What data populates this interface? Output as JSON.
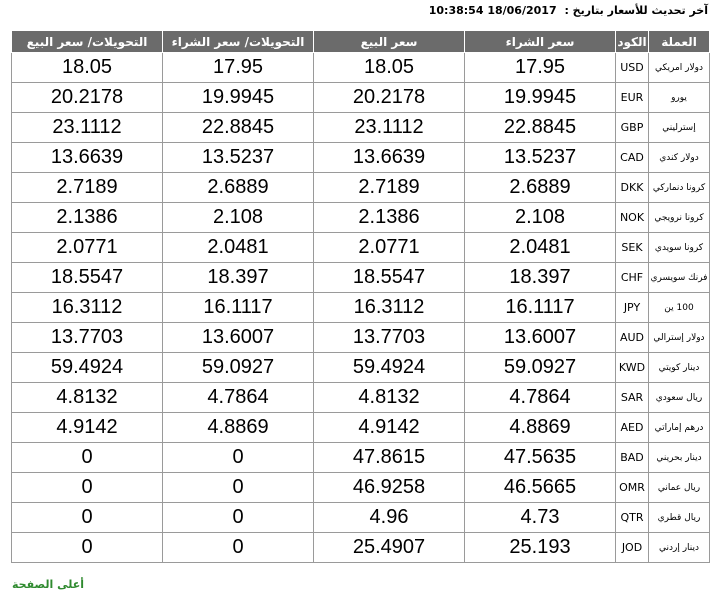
{
  "header": {
    "updated_label": "آخر تحديث للأسعار بتاريخ :",
    "updated_value": "18/06/2017 10:38:54"
  },
  "table": {
    "columns": [
      "العملة",
      "الكود",
      "سعر الشراء",
      "سعر البيع",
      "التحويلات/ سعر الشراء",
      "التحويلات/ سعر البيع"
    ],
    "rows": [
      {
        "name": "دولار امريكي",
        "code": "USD",
        "buy": "17.95",
        "sell": "18.05",
        "transfer_buy": "17.95",
        "transfer_sell": "18.05"
      },
      {
        "name": "يورو",
        "code": "EUR",
        "buy": "19.9945",
        "sell": "20.2178",
        "transfer_buy": "19.9945",
        "transfer_sell": "20.2178"
      },
      {
        "name": "إسترليني",
        "code": "GBP",
        "buy": "22.8845",
        "sell": "23.1112",
        "transfer_buy": "22.8845",
        "transfer_sell": "23.1112"
      },
      {
        "name": "دولار كندي",
        "code": "CAD",
        "buy": "13.5237",
        "sell": "13.6639",
        "transfer_buy": "13.5237",
        "transfer_sell": "13.6639"
      },
      {
        "name": "كرونا دنماركي",
        "code": "DKK",
        "buy": "2.6889",
        "sell": "2.7189",
        "transfer_buy": "2.6889",
        "transfer_sell": "2.7189"
      },
      {
        "name": "كرونا نرويجي",
        "code": "NOK",
        "buy": "2.108",
        "sell": "2.1386",
        "transfer_buy": "2.108",
        "transfer_sell": "2.1386"
      },
      {
        "name": "كرونا سويدي",
        "code": "SEK",
        "buy": "2.0481",
        "sell": "2.0771",
        "transfer_buy": "2.0481",
        "transfer_sell": "2.0771"
      },
      {
        "name": "فرنك سويسري",
        "code": "CHF",
        "buy": "18.397",
        "sell": "18.5547",
        "transfer_buy": "18.397",
        "transfer_sell": "18.5547"
      },
      {
        "name": "100 ين",
        "code": "JPY",
        "buy": "16.1117",
        "sell": "16.3112",
        "transfer_buy": "16.1117",
        "transfer_sell": "16.3112"
      },
      {
        "name": "دولار إسترالي",
        "code": "AUD",
        "buy": "13.6007",
        "sell": "13.7703",
        "transfer_buy": "13.6007",
        "transfer_sell": "13.7703"
      },
      {
        "name": "دينار كويتي",
        "code": "KWD",
        "buy": "59.0927",
        "sell": "59.4924",
        "transfer_buy": "59.0927",
        "transfer_sell": "59.4924"
      },
      {
        "name": "ريال سعودي",
        "code": "SAR",
        "buy": "4.7864",
        "sell": "4.8132",
        "transfer_buy": "4.7864",
        "transfer_sell": "4.8132"
      },
      {
        "name": "درهم إماراتي",
        "code": "AED",
        "buy": "4.8869",
        "sell": "4.9142",
        "transfer_buy": "4.8869",
        "transfer_sell": "4.9142"
      },
      {
        "name": "دينار بحريني",
        "code": "BAD",
        "buy": "47.5635",
        "sell": "47.8615",
        "transfer_buy": "0",
        "transfer_sell": "0"
      },
      {
        "name": "ريال عماني",
        "code": "OMR",
        "buy": "46.5665",
        "sell": "46.9258",
        "transfer_buy": "0",
        "transfer_sell": "0"
      },
      {
        "name": "ريال قطري",
        "code": "QTR",
        "buy": "4.73",
        "sell": "4.96",
        "transfer_buy": "0",
        "transfer_sell": "0"
      },
      {
        "name": "دينار إردني",
        "code": "JOD",
        "buy": "25.193",
        "sell": "25.4907",
        "transfer_buy": "0",
        "transfer_sell": "0"
      }
    ]
  },
  "footer": {
    "top_link": "أعلى الصفحة"
  }
}
